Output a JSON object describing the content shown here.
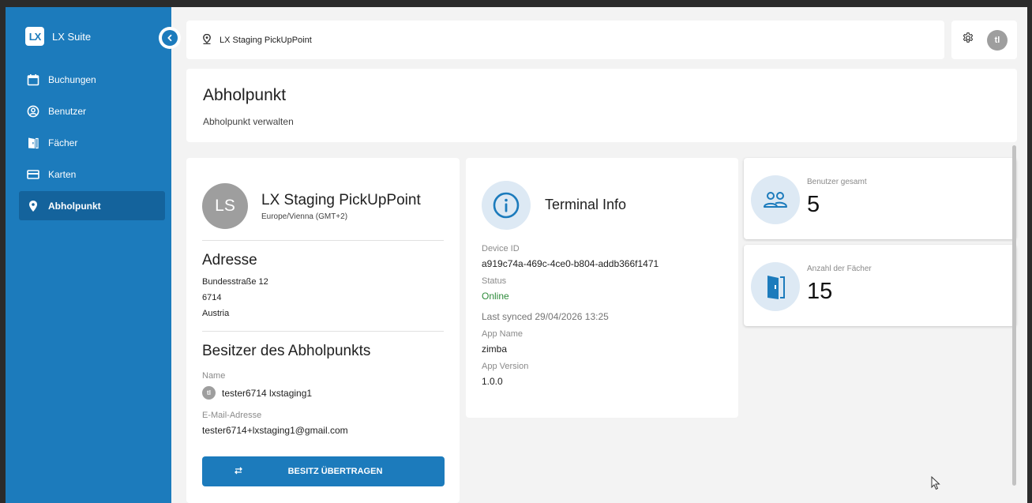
{
  "brand": {
    "logo": "LX",
    "name": "LX Suite"
  },
  "sidebar": {
    "items": [
      {
        "label": "Buchungen",
        "icon": "calendar-icon"
      },
      {
        "label": "Benutzer",
        "icon": "user-circle-icon"
      },
      {
        "label": "Fächer",
        "icon": "door-icon"
      },
      {
        "label": "Karten",
        "icon": "card-icon"
      },
      {
        "label": "Abholpunkt",
        "icon": "location-pin-icon",
        "active": true
      }
    ]
  },
  "topbar": {
    "location": "LX Staging PickUpPoint",
    "avatar_initials": "tl"
  },
  "header": {
    "title": "Abholpunkt",
    "subtitle": "Abholpunkt verwalten"
  },
  "pickup": {
    "initials": "LS",
    "name": "LX Staging PickUpPoint",
    "timezone": "Europe/Vienna (GMT+2)"
  },
  "address": {
    "heading": "Adresse",
    "street": "Bundesstraße 12",
    "zip": "6714",
    "country": "Austria"
  },
  "owner": {
    "heading": "Besitzer des Abholpunkts",
    "name_label": "Name",
    "initials": "tl",
    "name": "tester6714 lxstaging1",
    "email_label": "E-Mail-Adresse",
    "email": "tester6714+lxstaging1@gmail.com",
    "transfer_label": "BESITZ ÜBERTRAGEN"
  },
  "terminal": {
    "title": "Terminal Info",
    "device_id_label": "Device ID",
    "device_id": "a919c74a-469c-4ce0-b804-addb366f1471",
    "status_label": "Status",
    "status": "Online",
    "last_synced": "Last synced 29/04/2026 13:25",
    "app_name_label": "App Name",
    "app_name": "zimba",
    "app_version_label": "App Version",
    "app_version": "1.0.0"
  },
  "stats": {
    "users_label": "Benutzer gesamt",
    "users_value": "5",
    "lockers_label": "Anzahl der Fächer",
    "lockers_value": "15"
  },
  "colors": {
    "primary": "#1c7bbc",
    "active_nav": "#14639c",
    "icon_bg": "#dde9f4",
    "online": "#2e8b3b"
  }
}
